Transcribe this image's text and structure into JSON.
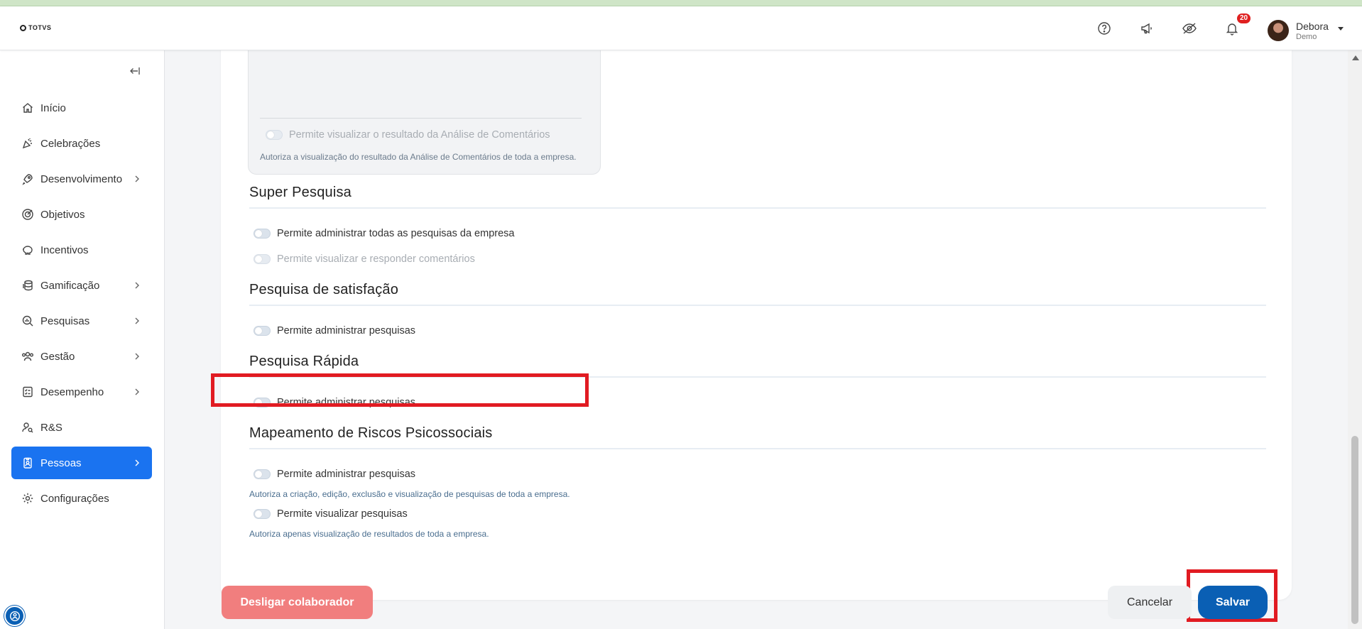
{
  "app": {
    "logo_text": "TOTVS"
  },
  "header": {
    "notifications_count": "20",
    "user_name": "Debora",
    "user_role": "Demo"
  },
  "sidebar": {
    "items": [
      {
        "label": "Início",
        "icon": "home-icon"
      },
      {
        "label": "Celebrações",
        "icon": "party-icon"
      },
      {
        "label": "Desenvolvimento",
        "icon": "rocket-icon"
      },
      {
        "label": "Objetivos",
        "icon": "target-icon"
      },
      {
        "label": "Incentivos",
        "icon": "piggy-bank-icon"
      },
      {
        "label": "Gamificação",
        "icon": "coins-icon"
      },
      {
        "label": "Pesquisas",
        "icon": "search-chart-icon"
      },
      {
        "label": "Gestão",
        "icon": "users-icon"
      },
      {
        "label": "Desempenho",
        "icon": "checklist-icon"
      },
      {
        "label": "R&S",
        "icon": "user-search-icon"
      },
      {
        "label": "Pessoas",
        "icon": "badge-icon"
      },
      {
        "label": "Configurações",
        "icon": "gear-icon"
      }
    ]
  },
  "permissions": {
    "comments_box": {
      "toggle_label": "Permite visualizar o resultado da Análise de Comentários",
      "description": "Autoriza a visualização do resultado da Análise de Comentários de toda a empresa."
    },
    "super_pesquisa": {
      "title": "Super Pesquisa",
      "opt1": "Permite administrar todas as pesquisas da empresa",
      "opt2": "Permite visualizar e responder comentários"
    },
    "satisfacao": {
      "title": "Pesquisa de satisfação",
      "opt1": "Permite administrar pesquisas"
    },
    "rapida": {
      "title": "Pesquisa Rápida",
      "opt1": "Permite administrar pesquisas"
    },
    "riscos": {
      "title": "Mapeamento de Riscos Psicossociais",
      "opt1": "Permite administrar pesquisas",
      "desc1": "Autoriza a criação, edição, exclusão e visualização de pesquisas de toda a empresa.",
      "opt2": "Permite visualizar pesquisas",
      "desc2": "Autoriza apenas visualização de resultados de toda a empresa."
    }
  },
  "actions": {
    "desligar": "Desligar colaborador",
    "cancelar": "Cancelar",
    "salvar": "Salvar"
  },
  "colors": {
    "primary": "#0a5fb4",
    "active_nav": "#1a73f0",
    "danger_soft": "#f17e7e",
    "highlight": "#e11b22"
  }
}
